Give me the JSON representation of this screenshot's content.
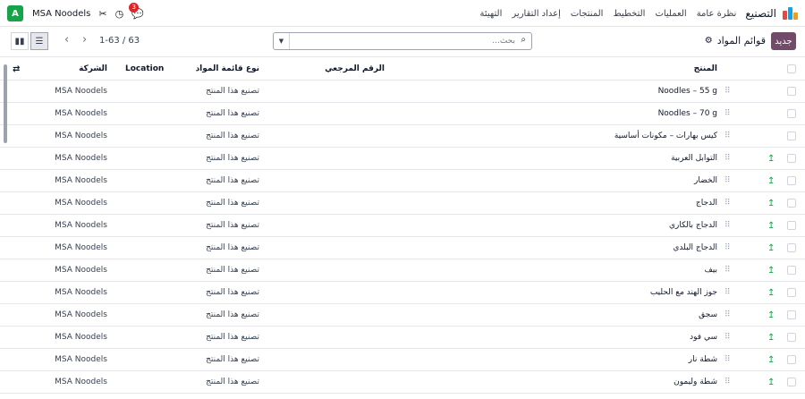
{
  "navbar": {
    "app_title": "التصنيع",
    "menu": [
      "نظرة عامة",
      "العمليات",
      "التخطيط",
      "المنتجات",
      "إعداد التقارير",
      "التهيئة"
    ],
    "company_initial": "A",
    "company_name": "MSA Noodels",
    "chat_count": "3"
  },
  "control": {
    "new_label": "جديد",
    "breadcrumb": "قوائم المواد",
    "search_placeholder": "بحث...",
    "pager": "1-63 / 63"
  },
  "table": {
    "headers": {
      "product": "المنتج",
      "reference": "الرقم المرجعي",
      "bom_type": "نوع قائمة المواد",
      "location": "Location",
      "company": "الشركة"
    },
    "rows": [
      {
        "product": "Noodles – 55 g",
        "type": "تصنيع هذا المنتج",
        "company": "MSA Noodels",
        "sorted": false
      },
      {
        "product": "Noodles – 70 g",
        "type": "تصنيع هذا المنتج",
        "company": "MSA Noodels",
        "sorted": false
      },
      {
        "product": "كيس بهارات – مكونات أساسية",
        "type": "تصنيع هذا المنتج",
        "company": "MSA Noodels",
        "sorted": false
      },
      {
        "product": "التوابل العربية",
        "type": "تصنيع هذا المنتج",
        "company": "MSA Noodels",
        "sorted": true
      },
      {
        "product": "الخضار",
        "type": "تصنيع هذا المنتج",
        "company": "MSA Noodels",
        "sorted": true
      },
      {
        "product": "الدجاج",
        "type": "تصنيع هذا المنتج",
        "company": "MSA Noodels",
        "sorted": true
      },
      {
        "product": "الدجاج بالكاري",
        "type": "تصنيع هذا المنتج",
        "company": "MSA Noodels",
        "sorted": true
      },
      {
        "product": "الدجاج البلدي",
        "type": "تصنيع هذا المنتج",
        "company": "MSA Noodels",
        "sorted": true
      },
      {
        "product": "بيف",
        "type": "تصنيع هذا المنتج",
        "company": "MSA Noodels",
        "sorted": true
      },
      {
        "product": "جوز الهند مع الحليب",
        "type": "تصنيع هذا المنتج",
        "company": "MSA Noodels",
        "sorted": true
      },
      {
        "product": "سجق",
        "type": "تصنيع هذا المنتج",
        "company": "MSA Noodels",
        "sorted": true
      },
      {
        "product": "سي فود",
        "type": "تصنيع هذا المنتج",
        "company": "MSA Noodels",
        "sorted": true
      },
      {
        "product": "شطة نار",
        "type": "تصنيع هذا المنتج",
        "company": "MSA Noodels",
        "sorted": true
      },
      {
        "product": "شطة وليمون",
        "type": "تصنيع هذا المنتج",
        "company": "MSA Noodels",
        "sorted": true
      }
    ]
  },
  "colors": {
    "brand": "#714b67",
    "company_badge": "#16a34a"
  }
}
